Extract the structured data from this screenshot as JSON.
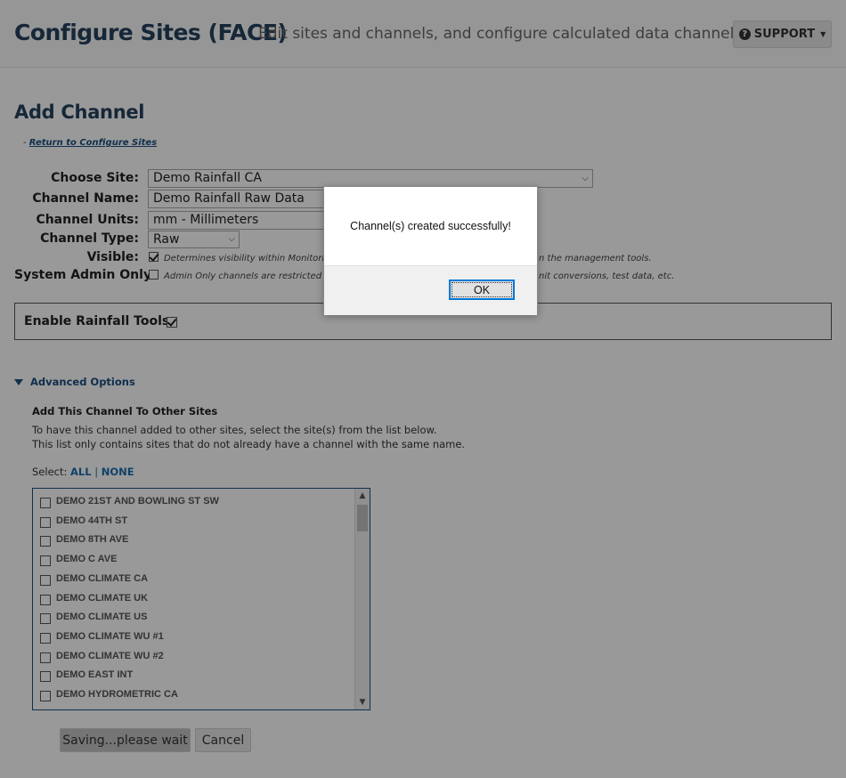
{
  "header": {
    "title": "Configure Sites (FACE)",
    "subtitle": "Edit sites and channels, and configure calculated data channels.",
    "support_label": "SUPPORT"
  },
  "form": {
    "heading": "Add Channel",
    "return_prefix": "-",
    "return_link": "Return to Configure Sites",
    "choose_site_label": "Choose Site:",
    "choose_site_value": "Demo Rainfall CA",
    "channel_name_label": "Channel Name:",
    "channel_name_value": "Demo Rainfall Raw Data",
    "channel_units_label": "Channel Units:",
    "channel_units_value": "mm - Millimeters",
    "channel_type_label": "Channel Type:",
    "channel_type_value": "Raw",
    "visible_label": "Visible:",
    "visible_checked": true,
    "visible_hint_left": "Determines visibility within Monitoring",
    "visible_hint_right": "n the management tools.",
    "admin_only_label": "System Admin Only:",
    "admin_only_checked": false,
    "admin_hint_left": "Admin Only channels are restricted to",
    "admin_hint_right": "nit conversions, test data, etc.",
    "rainfall_tools_label": "Enable Rainfall Tools:",
    "rainfall_tools_checked": true
  },
  "advanced": {
    "toggle_label": "Advanced Options",
    "heading": "Add This Channel To Other Sites",
    "line1": "To have this channel added to other sites, select the site(s) from the list below.",
    "line2": "This list only contains sites that do not already have a channel with the same name.",
    "select_prefix": "Select:",
    "select_all": "ALL",
    "select_sep": "|",
    "select_none": "NONE",
    "sites": [
      "DEMO 21ST AND BOWLING ST SW",
      "DEMO 44TH ST",
      "DEMO 8TH AVE",
      "DEMO C AVE",
      "DEMO CLIMATE CA",
      "DEMO CLIMATE UK",
      "DEMO CLIMATE US",
      "DEMO CLIMATE WU #1",
      "DEMO CLIMATE WU #2",
      "DEMO EAST INT",
      "DEMO HYDROMETRIC CA"
    ]
  },
  "buttons": {
    "saving": "Saving...please wait",
    "cancel": "Cancel"
  },
  "dialog": {
    "message": "Channel(s) created successfully!",
    "ok": "OK"
  }
}
